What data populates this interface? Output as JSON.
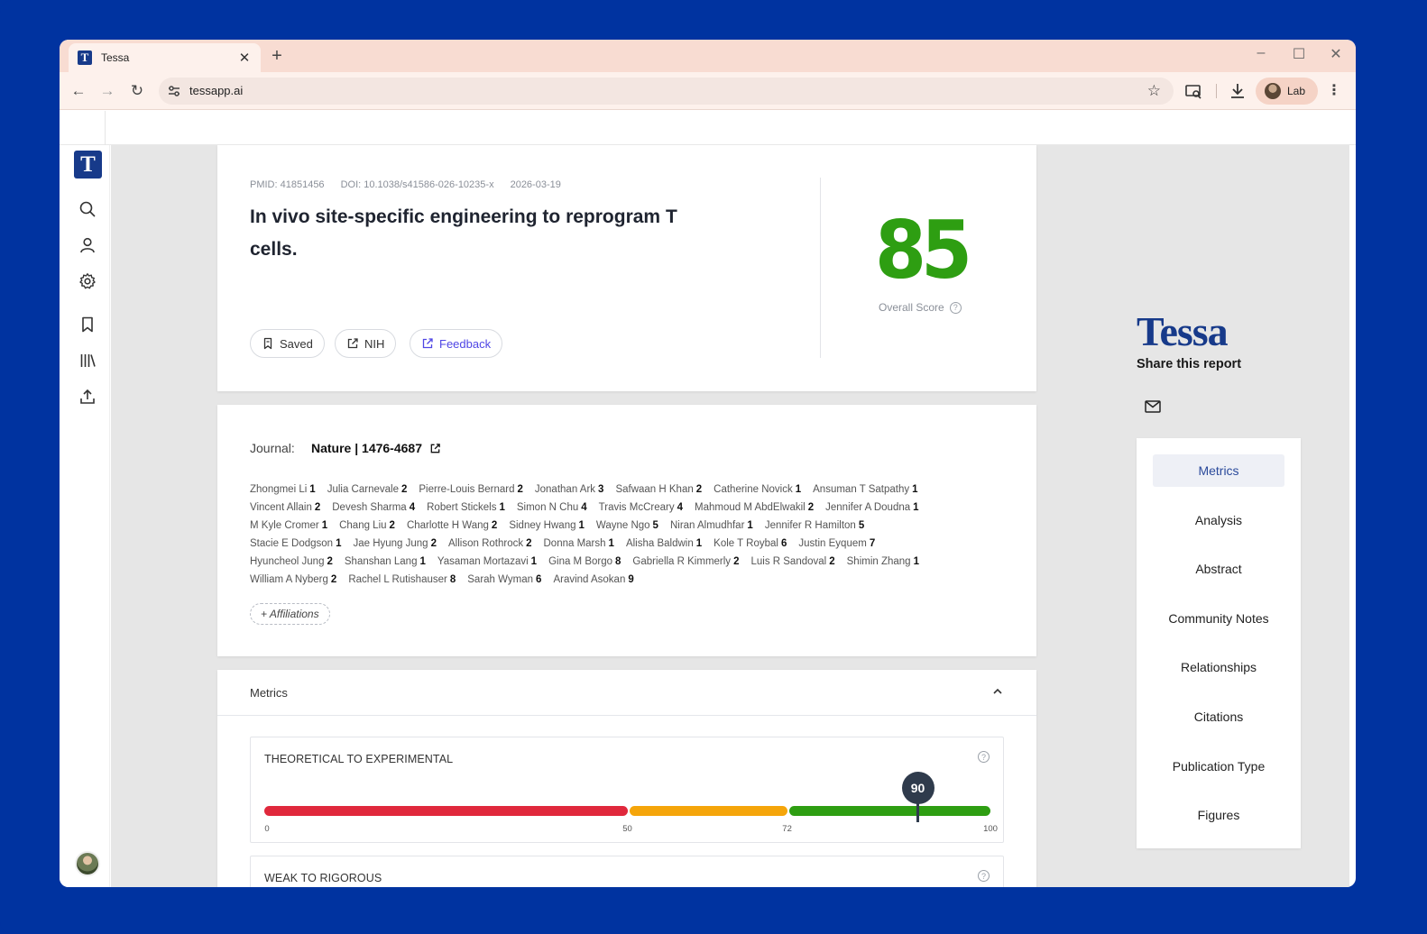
{
  "browser": {
    "tab_title": "Tessa",
    "tab_favicon_letter": "T",
    "url": "tessapp.ai",
    "profile_label": "Lab",
    "icons": [
      "back-icon",
      "forward-icon",
      "reload-icon",
      "site-settings-icon",
      "star-icon",
      "cast-icon",
      "download-icon",
      "menu-icon"
    ]
  },
  "sidebar": {
    "logo_letter": "T",
    "icons": [
      "search-icon",
      "user-icon",
      "gear-icon",
      "bookmark-icon",
      "library-icon",
      "upload-icon"
    ]
  },
  "paper": {
    "pmid": "PMID: 41851456",
    "doi": "DOI: 10.1038/s41586-026-10235-x",
    "date": "2026-03-19",
    "title": "In vivo site-specific engineering to reprogram T cells.",
    "score": "85",
    "score_label": "Overall Score",
    "score_color": "#2e9e12",
    "actions": {
      "saved": "Saved",
      "nih": "NIH",
      "feedback": "Feedback"
    }
  },
  "journal": {
    "label": "Journal:",
    "value": "Nature | 1476-4687"
  },
  "authors": [
    [
      [
        "Zhongmei Li",
        "1"
      ],
      [
        "Julia Carnevale",
        "2"
      ],
      [
        "Pierre-Louis Bernard",
        "2"
      ],
      [
        "Jonathan Ark",
        "3"
      ],
      [
        "Safwaan H Khan",
        "2"
      ],
      [
        "Catherine Novick",
        "1"
      ],
      [
        "Ansuman T Satpathy",
        "1"
      ]
    ],
    [
      [
        "Vincent Allain",
        "2"
      ],
      [
        "Devesh Sharma",
        "4"
      ],
      [
        "Robert Stickels",
        "1"
      ],
      [
        "Simon N Chu",
        "4"
      ],
      [
        "Travis McCreary",
        "4"
      ],
      [
        "Mahmoud M AbdElwakil",
        "2"
      ],
      [
        "Jennifer A Doudna",
        "1"
      ]
    ],
    [
      [
        "M Kyle Cromer",
        "1"
      ],
      [
        "Chang Liu",
        "2"
      ],
      [
        "Charlotte H Wang",
        "2"
      ],
      [
        "Sidney Hwang",
        "1"
      ],
      [
        "Wayne Ngo",
        "5"
      ],
      [
        "Niran Almudhfar",
        "1"
      ],
      [
        "Jennifer R Hamilton",
        "5"
      ]
    ],
    [
      [
        "Stacie E Dodgson",
        "1"
      ],
      [
        "Jae Hyung Jung",
        "2"
      ],
      [
        "Allison Rothrock",
        "2"
      ],
      [
        "Donna Marsh",
        "1"
      ],
      [
        "Alisha Baldwin",
        "1"
      ],
      [
        "Kole T Roybal",
        "6"
      ],
      [
        "Justin Eyquem",
        "7"
      ]
    ],
    [
      [
        "Hyuncheol Jung",
        "2"
      ],
      [
        "Shanshan Lang",
        "1"
      ],
      [
        "Yasaman Mortazavi",
        "1"
      ],
      [
        "Gina M Borgo",
        "8"
      ],
      [
        "Gabriella R Kimmerly",
        "2"
      ],
      [
        "Luis R Sandoval",
        "2"
      ],
      [
        "Shimin Zhang",
        "1"
      ]
    ],
    [
      [
        "William A Nyberg",
        "2"
      ],
      [
        "Rachel L Rutishauser",
        "8"
      ],
      [
        "Sarah Wyman",
        "6"
      ],
      [
        "Aravind Asokan",
        "9"
      ]
    ]
  ],
  "affiliations_button": "+ Affiliations",
  "metrics": {
    "section_title": "Metrics",
    "items": [
      {
        "label": "THEORETICAL TO EXPERIMENTAL",
        "value": 90,
        "value_label": "90",
        "thresholds": [
          0,
          50,
          72,
          100
        ],
        "tick_labels": [
          "0",
          "50",
          "72",
          "100"
        ],
        "colors": [
          "#e0283c",
          "#f5a50a",
          "#2e9e12"
        ]
      },
      {
        "label": "WEAK TO RIGOROUS"
      }
    ]
  },
  "right_panel": {
    "brand": "Tessa",
    "share_title": "Share this report",
    "share_icons": [
      "mail-icon"
    ],
    "nav": [
      "Metrics",
      "Analysis",
      "Abstract",
      "Community Notes",
      "Relationships",
      "Citations",
      "Publication Type",
      "Figures"
    ],
    "active_nav": "Metrics"
  }
}
